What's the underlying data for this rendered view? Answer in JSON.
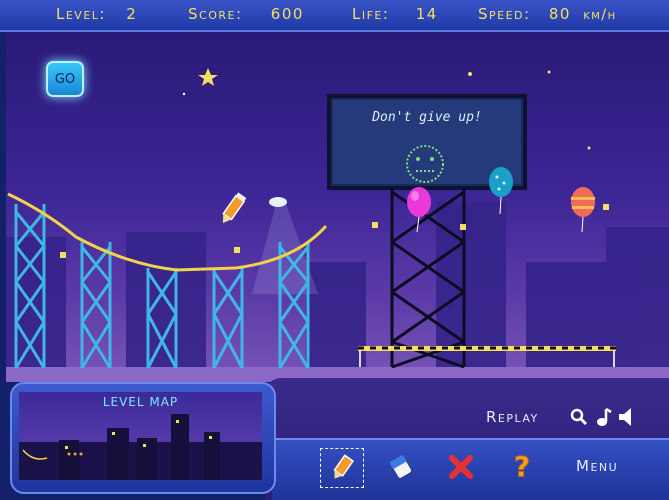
{
  "hud": {
    "level_label": "Level:",
    "level_value": "2",
    "score_label": "Score:",
    "score_value": "600",
    "life_label": "Life:",
    "life_value": "14",
    "speed_label": "Speed:",
    "speed_value": "80",
    "speed_unit": "km/h"
  },
  "controls": {
    "go_label": "GO",
    "replay_label": "Replay",
    "menu_label": "Menu"
  },
  "billboard": {
    "text": "Don't give up!"
  },
  "level_map": {
    "title": "LEVEL MAP"
  },
  "icons": {
    "go": "go-button",
    "zoom": "magnifier-icon",
    "music": "music-note-icon",
    "sound": "speaker-icon",
    "pencil": "pencil-icon",
    "eraser": "eraser-icon",
    "delete": "red-x-icon",
    "help": "question-mark-icon"
  },
  "colors": {
    "hud_text": "#f3e063",
    "accent": "#7fe6ff",
    "track": "#f3d24a",
    "girder": "#3fb6e6"
  }
}
